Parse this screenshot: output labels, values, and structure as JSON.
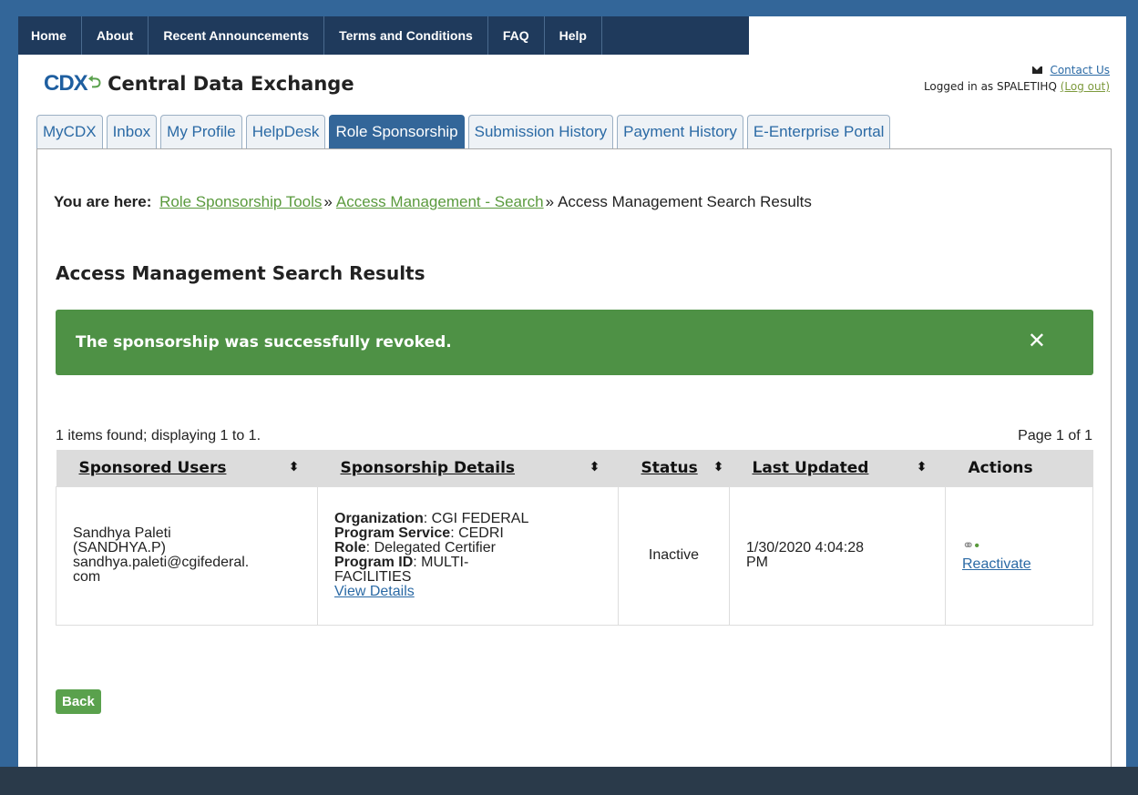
{
  "topnav": [
    "Home",
    "About",
    "Recent Announcements",
    "Terms and Conditions",
    "FAQ",
    "Help"
  ],
  "brand": {
    "logo": "CDX",
    "name": "Central Data Exchange"
  },
  "account": {
    "contact": "Contact Us",
    "logged_in": "Logged in as SPALETIHQ",
    "logout": "(Log out)"
  },
  "tabs": [
    "MyCDX",
    "Inbox",
    "My Profile",
    "HelpDesk",
    "Role Sponsorship",
    "Submission History",
    "Payment History",
    "E-Enterprise Portal"
  ],
  "active_tab": "Role Sponsorship",
  "breadcrumb": {
    "label": "You are here:",
    "items": [
      "Role Sponsorship Tools",
      "Access Management - Search"
    ],
    "sep": "»",
    "current": "Access Management Search Results"
  },
  "page_title": "Access Management Search Results",
  "alert": {
    "message": "The sponsorship was successfully revoked.",
    "close": "✕"
  },
  "results": {
    "count_text": "1 items found; displaying 1 to 1.",
    "page_text": "Page 1 of 1",
    "columns": [
      "Sponsored Users",
      "Sponsorship Details",
      "Status",
      "Last Updated",
      "Actions"
    ],
    "sort_icon": "⬍",
    "rows": [
      {
        "user_name": "Sandhya Paleti",
        "user_id": "(SANDHYA.P)",
        "user_email_1": "sandhya.paleti@cgifederal.",
        "user_email_2": "com",
        "org_label": "Organization",
        "org_value": ": CGI FEDERAL",
        "svc_label": "Program Service",
        "svc_value": ": CEDRI",
        "role_label": "Role",
        "role_value": ": Delegated Certifier",
        "pid_label": "Program ID",
        "pid_value": ": MULTI-",
        "pid_value2": "FACILITIES",
        "view_details": "View Details",
        "status": "Inactive",
        "updated_1": "1/30/2020 4:04:28",
        "updated_2": "PM",
        "action": "Reactivate"
      }
    ]
  },
  "back_button": "Back",
  "colors": {
    "brand_blue": "#336699",
    "success_green": "#4e9145",
    "link": "#2b6aa5"
  }
}
